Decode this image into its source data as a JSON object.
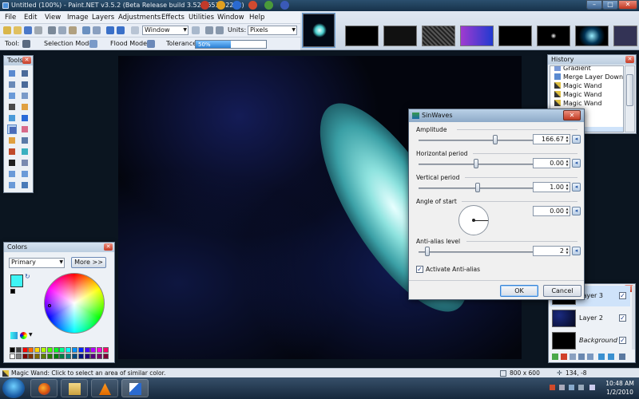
{
  "window": {
    "title": "Untitled (100%) - Paint.NET v3.5.2 (Beta Release build 3.52.3653.32292)",
    "min_glyph": "–",
    "max_glyph": "□",
    "close_glyph": "✕"
  },
  "menu": [
    "File",
    "Edit",
    "View",
    "Image",
    "Layers",
    "Adjustments",
    "Effects",
    "Utilities",
    "Window",
    "Help"
  ],
  "toolbar": {
    "zoom_combo": "Window",
    "units_label": "Units:",
    "units_value": "Pixels",
    "tool_label": "Tool:",
    "selection_mode_label": "Selection Mode:",
    "flood_mode_label": "Flood Mode:",
    "tolerance_label": "Tolerance:",
    "tolerance_text": "50%",
    "tolerance_value": 0.5
  },
  "tools_panel": {
    "title": "Tools",
    "close": "✕"
  },
  "colors_panel": {
    "title": "Colors",
    "close": "✕",
    "mode": "Primary",
    "more_button": "More >>",
    "primary_color": "#3ef5f5",
    "secondary_color": "#ffffff"
  },
  "history_panel": {
    "title": "History",
    "close": "✕",
    "items": [
      "Gradient",
      "Merge Layer Down",
      "Magic Wand",
      "Magic Wand",
      "Magic Wand"
    ]
  },
  "layers_panel": {
    "close": "✕",
    "layers": [
      {
        "name": "Layer 3",
        "checked": "✓"
      },
      {
        "name": "Layer 2",
        "checked": "✓"
      },
      {
        "name": "Background",
        "checked": "✓"
      }
    ]
  },
  "dialog": {
    "title": "SinWaves",
    "close": "✕",
    "reset_glyph": "◂",
    "params": [
      {
        "label": "Amplitude",
        "value": "166.67",
        "slider": 0.67
      },
      {
        "label": "Horizontal period",
        "value": "0.00",
        "slider": 0.5
      },
      {
        "label": "Vertical period",
        "value": "1.00",
        "slider": 0.52
      },
      {
        "label": "Angle of start",
        "value": "0.00"
      },
      {
        "label": "Anti-alias level",
        "value": "2",
        "slider": 0.08
      }
    ],
    "antialias_check": "✓",
    "antialias_label": "Activate Anti-alias",
    "ok": "OK",
    "cancel": "Cancel"
  },
  "status": {
    "hint": "Magic Wand: Click to select an area of similar color.",
    "size": "800 x 600",
    "cursor": "134, -8"
  },
  "clock": {
    "time": "10:48 AM",
    "date": "1/2/2010"
  }
}
